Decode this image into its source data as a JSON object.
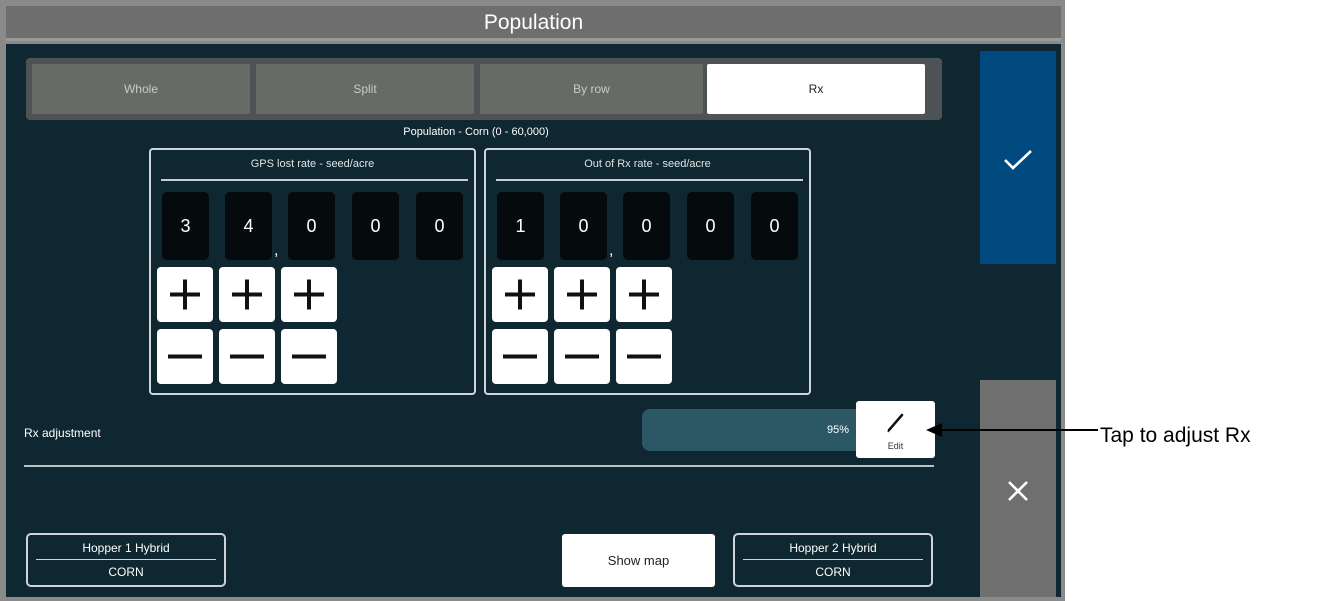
{
  "title": "Population",
  "tabs": [
    {
      "label": "Whole",
      "active": false
    },
    {
      "label": "Split",
      "active": false
    },
    {
      "label": "By row",
      "active": false
    },
    {
      "label": "Rx",
      "active": true
    }
  ],
  "range_label": "Population - Corn (0 - 60,000)",
  "gps_panel": {
    "title": "GPS lost rate - seed/acre",
    "digits": [
      "3",
      "4",
      "0",
      "0",
      "0"
    ],
    "separator": ","
  },
  "rx_panel": {
    "title": "Out of Rx rate - seed/acre",
    "digits": [
      "1",
      "0",
      "0",
      "0",
      "0"
    ],
    "separator": ","
  },
  "rx_adjustment": {
    "label": "Rx adjustment",
    "value": "95%",
    "edit_label": "Edit"
  },
  "hopper1": {
    "title": "Hopper 1 Hybrid",
    "value": "CORN"
  },
  "hopper2": {
    "title": "Hopper 2 Hybrid",
    "value": "CORN"
  },
  "show_map_label": "Show map",
  "actions": {
    "confirm_icon": "check-icon",
    "cancel_icon": "close-icon"
  },
  "callout": "Tap to adjust Rx",
  "colors": {
    "accent": "#004a7f",
    "background": "#0f2730",
    "rx_bar": "#2c5866",
    "cancel": "#6f6f6f"
  }
}
